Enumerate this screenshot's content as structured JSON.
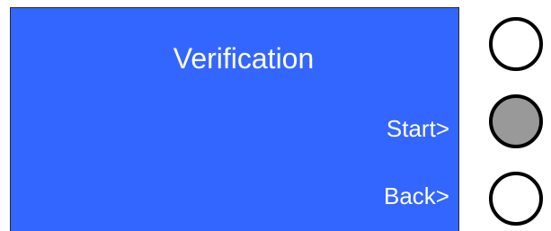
{
  "screen": {
    "title": "Verification",
    "softkeys": [
      {
        "label": "Start>"
      },
      {
        "label": "Back>"
      }
    ],
    "background_color": "#3366ff",
    "text_color": "#ffffff"
  },
  "buttons": [
    {
      "state": "normal",
      "fill": "#ffffff"
    },
    {
      "state": "pressed",
      "fill": "#999999"
    },
    {
      "state": "normal",
      "fill": "#ffffff"
    }
  ]
}
